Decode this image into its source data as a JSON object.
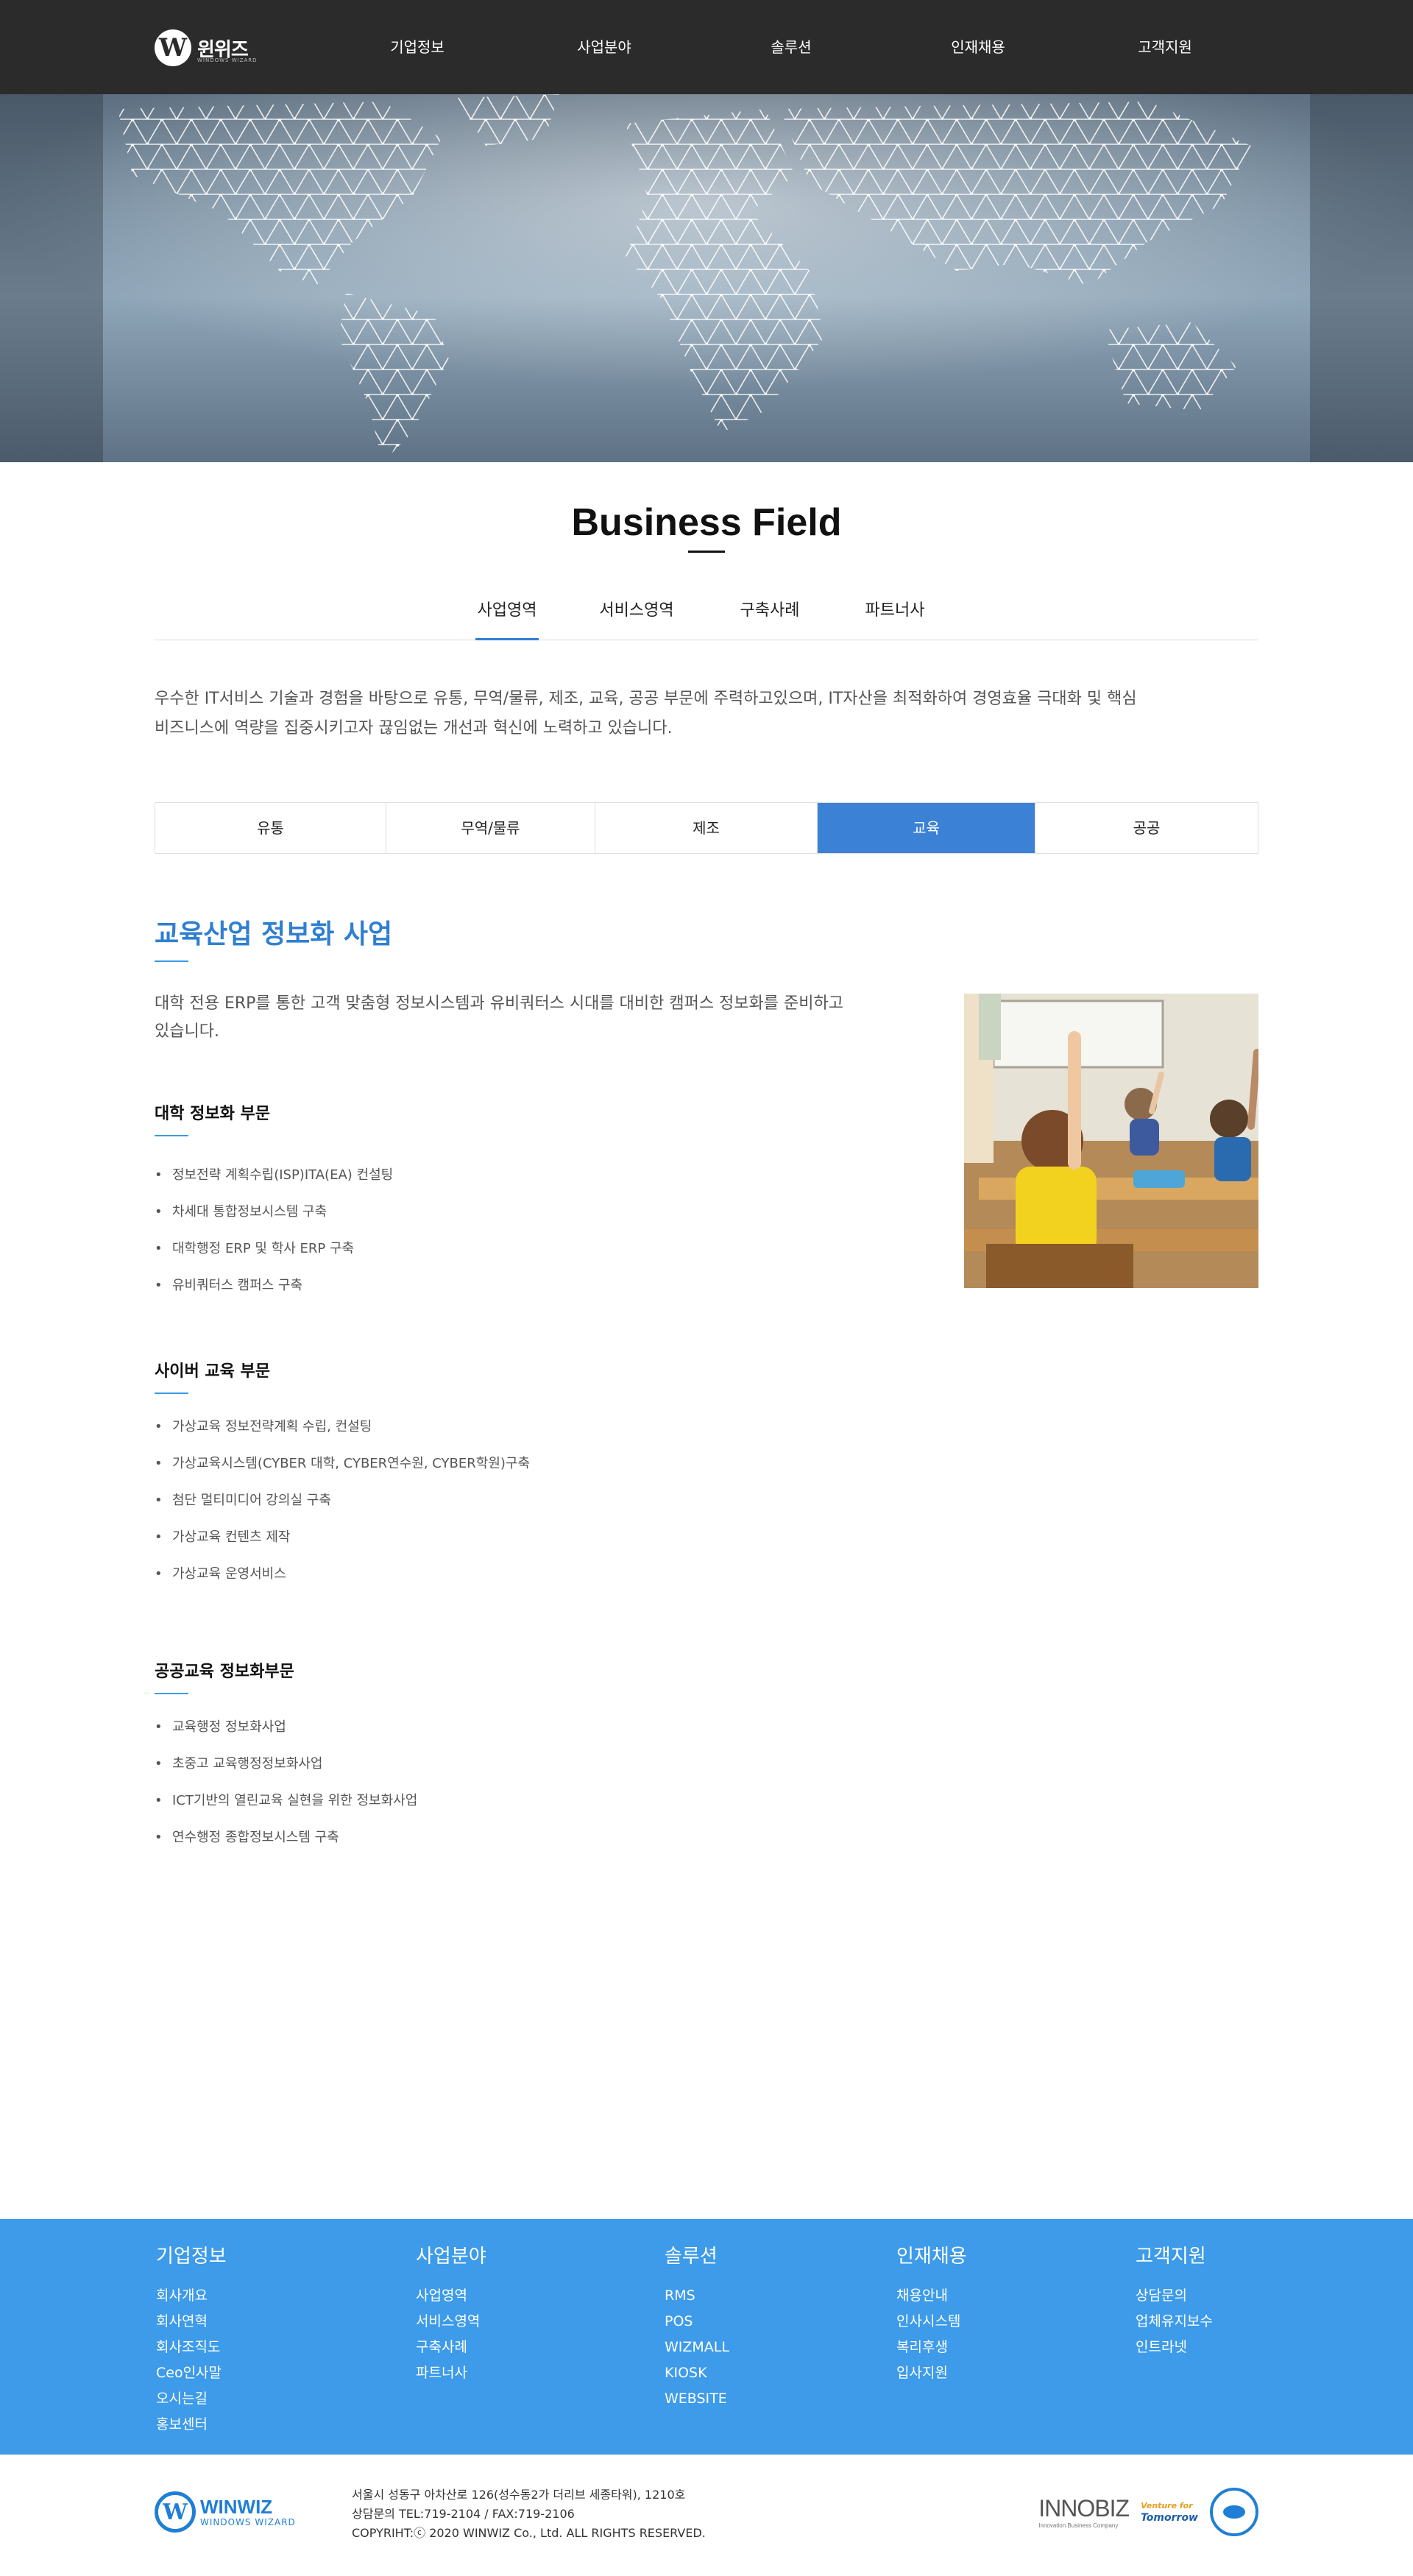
{
  "header": {
    "logo_text": "윈위즈",
    "logo_sub": "WINDOWS WIZARD",
    "nav": [
      "기업정보",
      "사업분야",
      "솔루션",
      "인재채용",
      "고객지원"
    ]
  },
  "page": {
    "title": "Business Field",
    "tabs": [
      "사업영역",
      "서비스영역",
      "구축사례",
      "파트너사"
    ],
    "active_tab": "사업영역",
    "intro_line1": "우수한 IT서비스 기술과 경험을 바탕으로 유통, 무역/물류, 제조, 교육, 공공 부문에 주력하고있으며, IT자산을 최적화하여 경영효율 극대화 및 핵심",
    "intro_line2": "비즈니스에 역량을 집중시키고자 끊임없는 개선과 혁신에 노력하고 있습니다.",
    "categories": [
      "유통",
      "무역/물류",
      "제조",
      "교육",
      "공공"
    ],
    "active_category": "교육"
  },
  "content": {
    "section_title": "교육산업 정보화 사업",
    "lead_line1": "대학 전용 ERP를 통한 고객 맞춤형 정보시스템과 유비쿼터스 시대를 대비한 캠퍼스 정보화를 준비하고",
    "lead_line2": "있습니다.",
    "groups": [
      {
        "title": "대학 정보화 부문",
        "items": [
          "정보전략 계획수립(ISP)ITA(EA) 컨설팅",
          "차세대 통합정보시스템 구축",
          "대학행정 ERP 및 학사 ERP 구축",
          "유비쿼터스 캠퍼스 구축"
        ]
      },
      {
        "title": "사이버 교육 부문",
        "items": [
          "가상교육 정보전략계획 수립, 컨설팅",
          "가상교육시스템(CYBER 대학, CYBER연수원, CYBER학원)구축",
          "첨단 멀티미디어 강의실 구축",
          "가상교육 컨텐츠 제작",
          "가상교육 운영서비스"
        ]
      },
      {
        "title": "공공교육 정보화부문",
        "items": [
          "교육행정 정보화사업",
          "초중고 교육행정정보화사업",
          "ICT기반의 열린교육 실현을 위한 정보화사업",
          "연수행정 종합정보시스템 구축"
        ]
      }
    ]
  },
  "footer": {
    "columns": [
      {
        "title": "기업정보",
        "items": [
          "회사개요",
          "회사연혁",
          "회사조직도",
          "Ceo인사말",
          "오시는길",
          "홍보센터"
        ]
      },
      {
        "title": "사업분야",
        "items": [
          "사업영역",
          "서비스영역",
          "구축사례",
          "파트너사"
        ]
      },
      {
        "title": "솔루션",
        "items": [
          "RMS",
          "POS",
          "WIZMALL",
          "KIOSK",
          "WEBSITE"
        ]
      },
      {
        "title": "인재채용",
        "items": [
          "채용안내",
          "인사시스템",
          "복리후생",
          "입사지원"
        ]
      },
      {
        "title": "고객지원",
        "items": [
          "상담문의",
          "업체유지보수",
          "인트라넷"
        ]
      }
    ],
    "logo_name": "WINWIZ",
    "logo_sub": "WINDOWS WIZARD",
    "address": "서울시 성동구 아차산로 126(성수동2가 더리브 세종타워), 1210호",
    "contact": "상담문의 TEL:719-2104 / FAX:719-2106",
    "copyright": "COPYRIHT:ⓒ 2020 WINWIZ Co., Ltd. ALL RIGHTS RESERVED.",
    "cert_innobiz": "INNOBIZ",
    "cert_innobiz_sub": "Innovation Business Company",
    "cert_venture_top": "Venture for",
    "cert_venture_main": "Tomorrow"
  },
  "colors": {
    "header_bg": "#2b2b2b",
    "accent": "#3b82d6",
    "footer_bg": "#3d9be9"
  }
}
